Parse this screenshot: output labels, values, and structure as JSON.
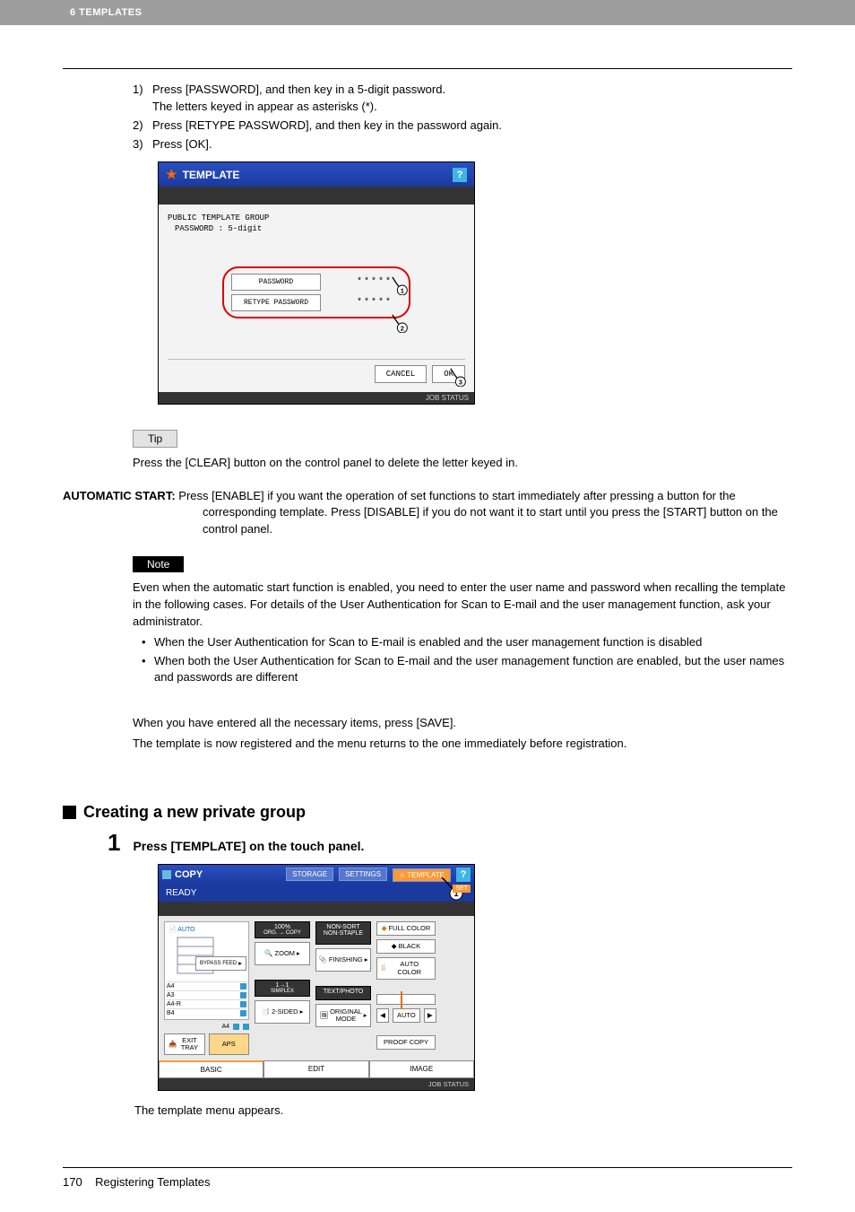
{
  "header": {
    "chapter": "6 TEMPLATES"
  },
  "steps": {
    "s1a": "Press [PASSWORD], and then key in a 5-digit password.",
    "s1b": "The letters keyed in appear as asterisks (*).",
    "s2": "Press [RETYPE PASSWORD], and then key in the password again.",
    "s3": "Press [OK]."
  },
  "screen1": {
    "title": "TEMPLATE",
    "help": "?",
    "group_line1": "PUBLIC TEMPLATE GROUP",
    "group_line2": "PASSWORD : 5-digit",
    "password_btn": "PASSWORD",
    "retype_btn": "RETYPE PASSWORD",
    "mask": "*****",
    "cancel": "CANCEL",
    "ok": "OK",
    "jobstatus": "JOB STATUS",
    "c1": "1",
    "c2": "2",
    "c3": "3"
  },
  "tip": {
    "label": "Tip",
    "text": "Press the [CLEAR] button on the control panel to delete the letter keyed in."
  },
  "auto": {
    "head": "AUTOMATIC START:",
    "body": " Press [ENABLE] if you want the operation of set functions to start immediately after pressing a button for the corresponding template. Press [DISABLE] if you do not want it to start until you press the [START] button on the control panel."
  },
  "note": {
    "label": "Note",
    "intro": "Even when the automatic start function is enabled, you need to enter the user name and password when recalling the template in the following cases. For details of the User Authentication for Scan to E-mail and the user management function, ask your administrator.",
    "b1": "When the User Authentication for Scan to E-mail is enabled and the user management function is disabled",
    "b2": "When both the User Authentication for Scan to E-mail and the user management function are enabled, but the user names and passwords are different"
  },
  "closing": {
    "l1": "When you have entered all the necessary items, press [SAVE].",
    "l2": "The template is now registered and the menu returns to the one immediately before registration."
  },
  "section": {
    "title": "Creating a new private group"
  },
  "step1": {
    "num": "1",
    "text": "Press [TEMPLATE] on the touch panel.",
    "after": "The template menu appears."
  },
  "screen2": {
    "copy": "COPY",
    "storage": "STORAGE",
    "settings": "SETTINGS",
    "template": "TEMPLATE",
    "help": "?",
    "ready": "READY",
    "auto": "AUTO",
    "bypass": "BYPASS FEED",
    "a4": "A4",
    "a3": "A3",
    "a4r": "A4-R",
    "b4": "B4",
    "a4b": "A4",
    "exit": "EXIT TRAY",
    "aps": "APS",
    "zoom_disp": "100%",
    "zoom_sub": "ORG. → COPY",
    "zoom": "ZOOM",
    "simplex_disp": "1→1",
    "simplex_sub": "SIMPLEX",
    "twosided": "2-SIDED",
    "finish_disp": "NON-SORT NON-STAPLE",
    "finishing": "FINISHING",
    "textphoto": "TEXT/PHOTO",
    "original": "ORIGINAL MODE",
    "full": "FULL COLOR",
    "black": "BLACK",
    "autoc": "AUTO COLOR",
    "autob": "AUTO",
    "proof": "PROOF COPY",
    "basic": "BASIC",
    "edit": "EDIT",
    "image": "IMAGE",
    "jobstatus": "JOB STATUS",
    "set": "SET",
    "c1": "1"
  },
  "footer": {
    "page": "170",
    "title": "Registering Templates"
  }
}
